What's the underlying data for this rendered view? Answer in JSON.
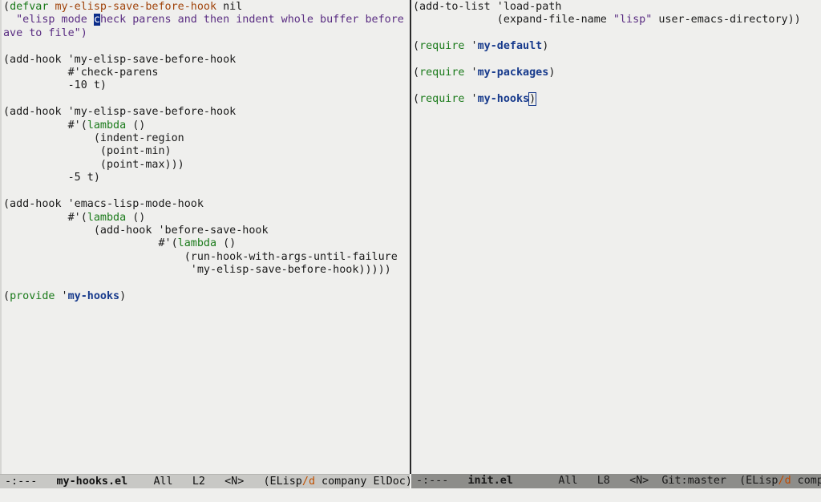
{
  "left_window": {
    "lines": [
      [
        {
          "t": "("
        },
        {
          "t": "defvar",
          "c": "kw"
        },
        {
          "t": " "
        },
        {
          "t": "my-elisp-save-before-hook",
          "c": "fn"
        },
        {
          "t": " nil"
        }
      ],
      [
        {
          "t": "  "
        },
        {
          "t": "\"elisp mode ",
          "c": "str"
        },
        {
          "t": "c",
          "c": "cursor"
        },
        {
          "t": "heck parens and then indent whole buffer before s",
          "c": "str"
        }
      ],
      [
        {
          "t": "ave to file\")",
          "c": "str"
        }
      ],
      [
        {
          "t": ""
        }
      ],
      [
        {
          "t": "(add-hook 'my-elisp-save-before-hook"
        }
      ],
      [
        {
          "t": "          #'check-parens"
        }
      ],
      [
        {
          "t": "          -10 t)"
        }
      ],
      [
        {
          "t": ""
        }
      ],
      [
        {
          "t": "(add-hook 'my-elisp-save-before-hook"
        }
      ],
      [
        {
          "t": "          #'("
        },
        {
          "t": "lambda",
          "c": "kw"
        },
        {
          "t": " ()"
        }
      ],
      [
        {
          "t": "              (indent-region"
        }
      ],
      [
        {
          "t": "               (point-min)"
        }
      ],
      [
        {
          "t": "               (point-max)))"
        }
      ],
      [
        {
          "t": "          -5 t)"
        }
      ],
      [
        {
          "t": ""
        }
      ],
      [
        {
          "t": "(add-hook 'emacs-lisp-mode-hook"
        }
      ],
      [
        {
          "t": "          #'("
        },
        {
          "t": "lambda",
          "c": "kw"
        },
        {
          "t": " ()"
        }
      ],
      [
        {
          "t": "              (add-hook 'before-save-hook"
        }
      ],
      [
        {
          "t": "                        #'("
        },
        {
          "t": "lambda",
          "c": "kw"
        },
        {
          "t": " ()"
        }
      ],
      [
        {
          "t": "                            (run-hook-with-args-until-failure"
        }
      ],
      [
        {
          "t": "                             'my-elisp-save-before-hook)))))"
        }
      ],
      [
        {
          "t": ""
        }
      ],
      [
        {
          "t": "("
        },
        {
          "t": "provide",
          "c": "kw"
        },
        {
          "t": " '"
        },
        {
          "t": "my-hooks",
          "c": "con"
        },
        {
          "t": ")"
        }
      ]
    ]
  },
  "right_window": {
    "lines": [
      [
        {
          "t": "(add-to-list 'load-path"
        }
      ],
      [
        {
          "t": "             (expand-file-name "
        },
        {
          "t": "\"lisp\"",
          "c": "str"
        },
        {
          "t": " user-emacs-directory))"
        }
      ],
      [
        {
          "t": ""
        }
      ],
      [
        {
          "t": "("
        },
        {
          "t": "require",
          "c": "kw"
        },
        {
          "t": " '"
        },
        {
          "t": "my-default",
          "c": "con"
        },
        {
          "t": ")"
        }
      ],
      [
        {
          "t": ""
        }
      ],
      [
        {
          "t": "("
        },
        {
          "t": "require",
          "c": "kw"
        },
        {
          "t": " '"
        },
        {
          "t": "my-packages",
          "c": "con"
        },
        {
          "t": ")"
        }
      ],
      [
        {
          "t": ""
        }
      ],
      [
        {
          "t": "("
        },
        {
          "t": "require",
          "c": "kw"
        },
        {
          "t": " '"
        },
        {
          "t": "my-hooks",
          "c": "con"
        },
        {
          "t": ")",
          "c": "paren-match"
        }
      ]
    ]
  },
  "modeline_left": {
    "status": "-:---",
    "buffer": "my-hooks.el",
    "position": "All",
    "line": "L2",
    "narrow": "<N>",
    "mode_open": "(ELisp",
    "mode_slash": "/",
    "mode_d": "d",
    "minor": " company ElDoc)"
  },
  "modeline_right": {
    "status": "-:---",
    "buffer": "init.el",
    "position": "All",
    "line": "L8",
    "narrow": "<N>",
    "vc": "Git:master",
    "mode_open": "(ELisp",
    "mode_slash": "/",
    "mode_d": "d",
    "minor": " comp"
  }
}
